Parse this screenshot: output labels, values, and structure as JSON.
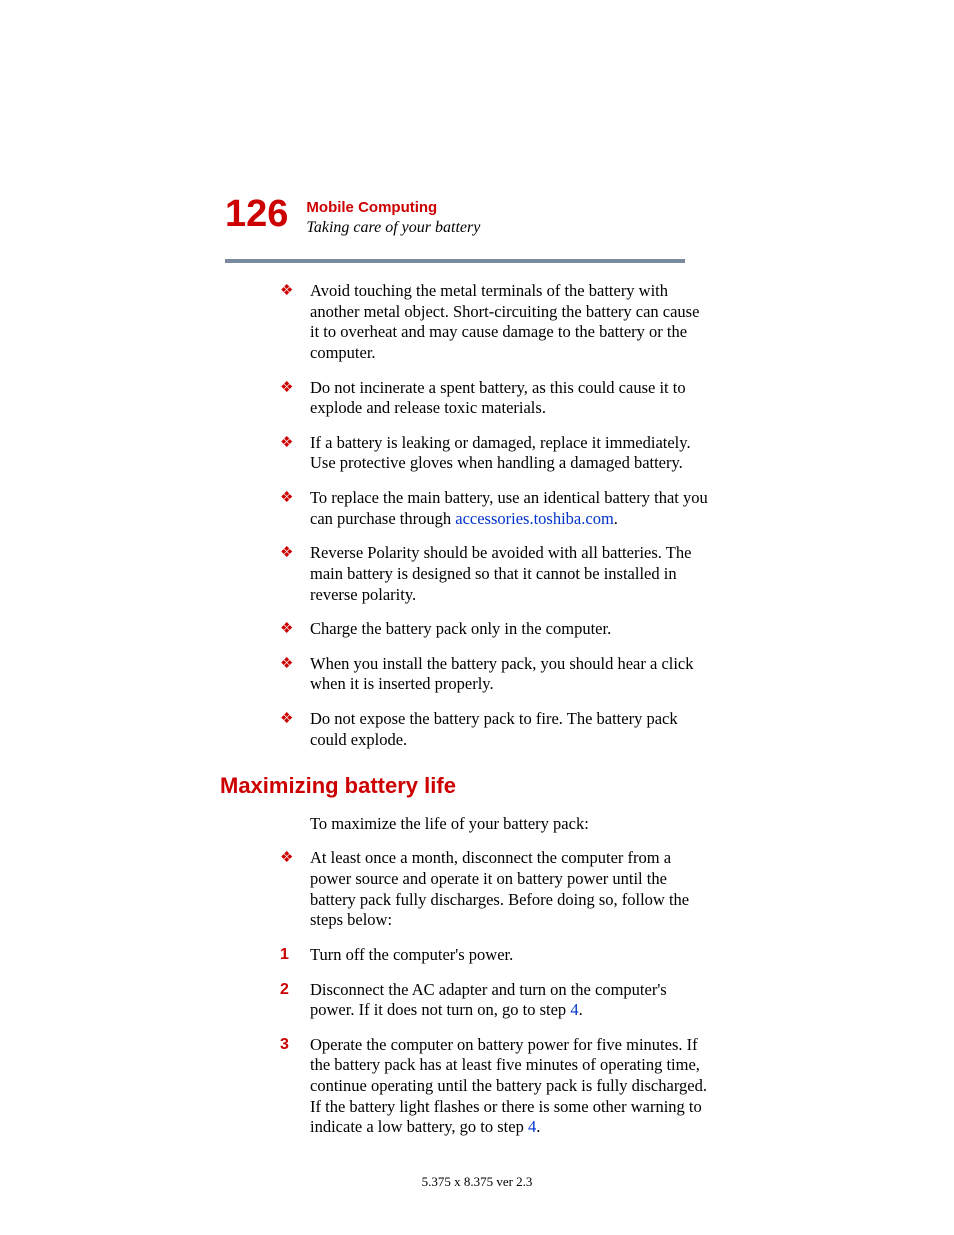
{
  "header": {
    "page_number": "126",
    "chapter": "Mobile Computing",
    "section": "Taking care of your battery"
  },
  "bullets": [
    {
      "text": "Avoid touching the metal terminals of the battery with another metal object. Short-circuiting the battery can cause it to overheat and may cause damage to the battery or the computer."
    },
    {
      "text": "Do not incinerate a spent battery, as this could cause it to explode and release toxic materials."
    },
    {
      "text": "If a battery is leaking or damaged, replace it immediately. Use protective gloves when handling a damaged battery."
    },
    {
      "pre": "To replace the main battery, use an identical battery that you can purchase through ",
      "link": "accessories.toshiba.com",
      "post": "."
    },
    {
      "text": "Reverse Polarity should be avoided with all batteries. The main battery is designed so that it cannot be installed in reverse polarity."
    },
    {
      "text": "Charge the battery pack only in the computer."
    },
    {
      "text": "When you install the battery pack, you should hear a click when it is inserted properly."
    },
    {
      "text": "Do not expose the battery pack to fire. The battery pack could explode."
    }
  ],
  "max_life": {
    "heading": "Maximizing battery life",
    "intro": "To maximize the life of your battery pack:",
    "bullet": "At least once a month, disconnect the computer from a power source and operate it on battery power until the battery pack fully discharges. Before doing so, follow the steps below:",
    "steps": [
      {
        "num": "1",
        "text": "Turn off the computer's power."
      },
      {
        "num": "2",
        "pre": "Disconnect the AC adapter and turn on the computer's power. If it does not turn on, go to step ",
        "link": "4",
        "post": "."
      },
      {
        "num": "3",
        "pre": "Operate the computer on battery power for five minutes. If the battery pack has at least five minutes of operating time, continue operating until the battery pack is fully discharged. If the battery light flashes or there is some other warning to indicate a low battery, go to step ",
        "link": "4",
        "post": "."
      }
    ]
  },
  "footer": "5.375 x 8.375 ver 2.3"
}
